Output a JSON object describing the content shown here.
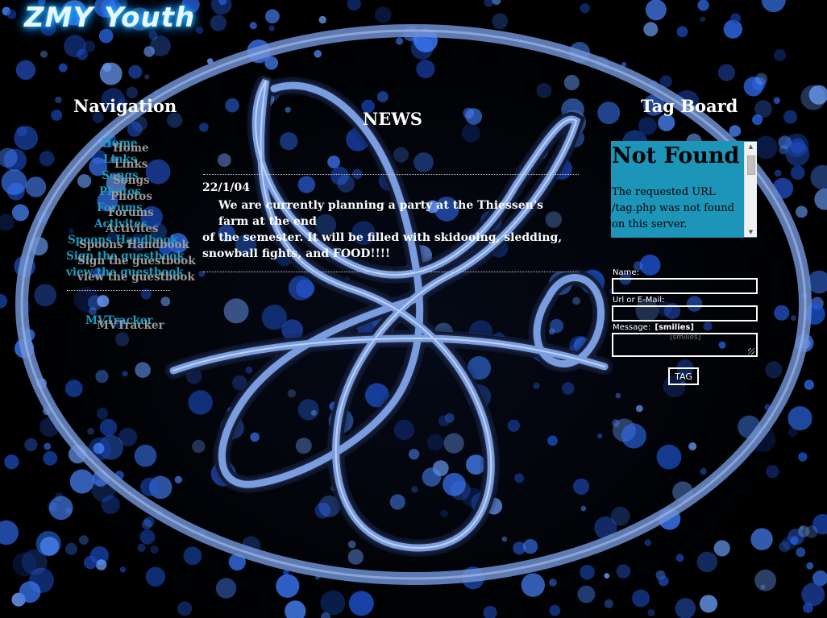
{
  "site": {
    "logo_text": "ZMY Youth"
  },
  "colors": {
    "link_primary": "#1a9cc0",
    "link_shadow": "#9b9b9b",
    "accent_ellipse": "#6f8fd0",
    "tagboard_bg": "#1d95b8"
  },
  "navigation": {
    "heading": "Navigation",
    "items": [
      {
        "label": "Home"
      },
      {
        "label": "Links"
      },
      {
        "label": "Songs"
      },
      {
        "label": "Photos"
      },
      {
        "label": "Forums"
      },
      {
        "label": "Activites"
      },
      {
        "label": "Spoons Handbook"
      },
      {
        "label": "Sign the guestbook"
      },
      {
        "label": "view the guestbook"
      }
    ],
    "tracker": {
      "label": "MVTracker"
    }
  },
  "news": {
    "heading": "NEWS",
    "date": "22/1/04",
    "line1": "We are currently planning a party at the Thiessen's farm at the end",
    "line2": "of the semester. It will be filled with skidooing, sledding, snowball fights, and FOOD!!!!"
  },
  "tagboard": {
    "heading": "Tag Board",
    "error_title": "Not Found",
    "error_text": "The requested URL /tag.php was not found on this server.",
    "name_label": "Name:",
    "url_label": "Url or E-Mail:",
    "message_label": "Message:",
    "smilies_label": "[smilies]",
    "message_hint": "[smilies]",
    "submit_label": "TAG"
  }
}
